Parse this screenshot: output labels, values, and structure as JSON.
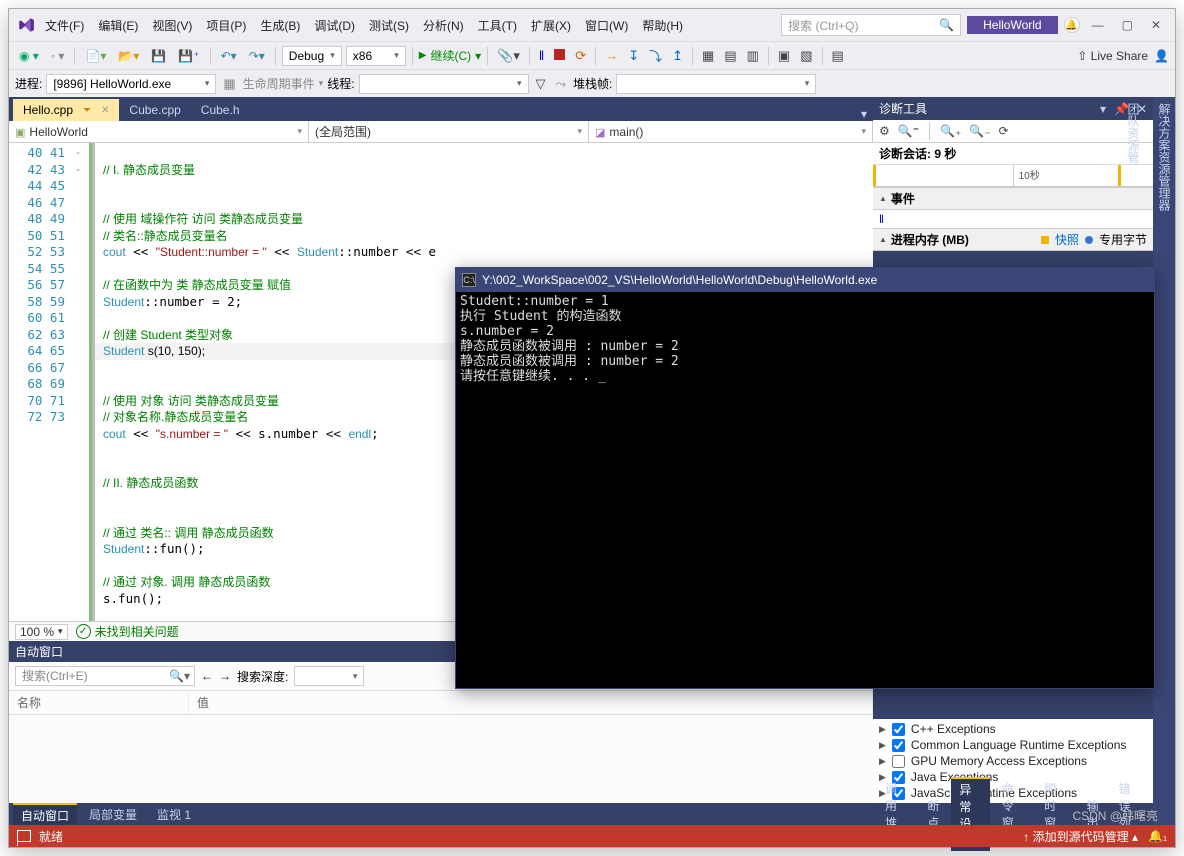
{
  "menu": [
    "文件(F)",
    "编辑(E)",
    "视图(V)",
    "项目(P)",
    "生成(B)",
    "调试(D)",
    "测试(S)",
    "分析(N)",
    "工具(T)",
    "扩展(X)",
    "窗口(W)",
    "帮助(H)"
  ],
  "searchPlaceholder": "搜索 (Ctrl+Q)",
  "solution": "HelloWorld",
  "toolbar": {
    "config": "Debug",
    "platform": "x86",
    "continue": "继续(C)",
    "liveShare": "Live Share"
  },
  "debugBar": {
    "processLabel": "进程:",
    "process": "[9896] HelloWorld.exe",
    "lifecycle": "生命周期事件",
    "thread": "线程:",
    "stackframe": "堆栈帧:"
  },
  "tabs": [
    {
      "label": "Hello.cpp",
      "active": true,
      "lock": true
    },
    {
      "label": "Cube.cpp",
      "active": false
    },
    {
      "label": "Cube.h",
      "active": false
    }
  ],
  "nav": {
    "scope": "HelloWorld",
    "context": "(全局范围)",
    "member": "main()"
  },
  "lines": [
    40,
    41,
    42,
    43,
    44,
    45,
    46,
    47,
    48,
    49,
    50,
    51,
    52,
    53,
    54,
    55,
    56,
    57,
    58,
    59,
    60,
    61,
    62,
    63,
    64,
    65,
    66,
    67,
    68,
    69,
    70,
    71,
    72,
    73
  ],
  "fold": {
    "45": "-",
    "55": "-"
  },
  "zoom": "100 %",
  "issues": "未找到相关问题",
  "diag": {
    "title": "诊断工具",
    "session": "诊断会话: 9 秒",
    "tick": "10秒",
    "eventsHdr": "事件",
    "memHdr": "进程内存 (MB)",
    "snapshot": "快照",
    "private": "专用字节"
  },
  "autoWin": {
    "title": "自动窗口",
    "searchPlaceholder": "搜索(Ctrl+E)",
    "depth": "搜索深度:",
    "col1": "名称",
    "col2": "值"
  },
  "bottomTabsLeft": [
    "自动窗口",
    "局部变量",
    "监视 1"
  ],
  "bottomTabsRight": [
    "调用堆栈",
    "断点",
    "异常设置",
    "命令窗口",
    "即时窗口",
    "输出",
    "错误列表"
  ],
  "exceptions": [
    {
      "label": "C++ Exceptions",
      "checked": true
    },
    {
      "label": "Common Language Runtime Exceptions",
      "checked": true
    },
    {
      "label": "GPU Memory Access Exceptions",
      "checked": false
    },
    {
      "label": "Java Exceptions",
      "checked": true
    },
    {
      "label": "JavaScript Runtime Exceptions",
      "checked": true
    }
  ],
  "status": {
    "ready": "就绪",
    "addSource": "添加到源代码管理"
  },
  "console": {
    "title": "Y:\\002_WorkSpace\\002_VS\\HelloWorld\\HelloWorld\\Debug\\HelloWorld.exe",
    "lines": [
      "Student::number = 1",
      "执行 Student 的构造函数",
      "s.number = 2",
      "静态成员函数被调用 : number = 2",
      "静态成员函数被调用 : number = 2",
      "请按任意键继续. . . _"
    ]
  },
  "vtabs": [
    "解决方案资源管理器",
    "团队资源管理器"
  ],
  "watermark": "CSDN @韩曙亮"
}
